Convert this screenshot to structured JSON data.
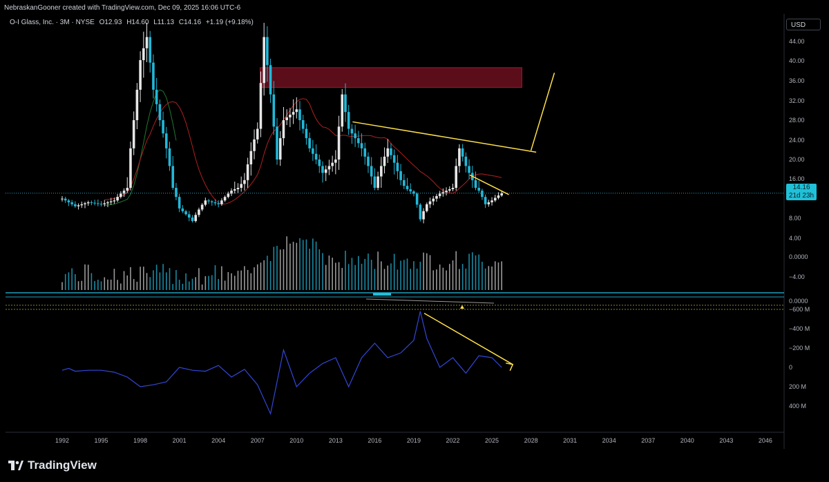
{
  "header": {
    "attribution": "NebraskanGooner created with TradingView.com, Dec 09, 2025 16:06 UTC-6"
  },
  "legend": {
    "symbol": "O-I Glass, Inc. · 3M · NYSE",
    "open_label": "O",
    "open": "12.93",
    "high_label": "H",
    "high": "14.60",
    "low_label": "L",
    "low": "11.13",
    "close_label": "C",
    "close": "14.16",
    "change": "+1.19 (+9.18%)"
  },
  "currency_button": "USD",
  "price_badge": {
    "price": "14.16",
    "countdown": "21d 23h",
    "color": "#20c0d8"
  },
  "branding": {
    "logo_icon": "tradingview-logo-icon",
    "name": "TradingView"
  },
  "colors": {
    "up": "#e6e6e6",
    "down": "#22b8d8",
    "resistance_zone": "#6b0f1e",
    "trendline": "#ffe14a",
    "ma_red": "#b02020",
    "ma_green": "#1f7a2e",
    "indicator_line": "#3347d6",
    "price_dotted": "#2aa9c9"
  },
  "chart_data": [
    {
      "type": "line",
      "title": "O-I Glass, Inc. · 3M · NYSE",
      "x_tick_labels": [
        "1992",
        "1995",
        "1998",
        "2001",
        "2004",
        "2007",
        "2010",
        "2013",
        "2016",
        "2019",
        "2022",
        "2025",
        "2028",
        "2031",
        "2034",
        "2037",
        "2040",
        "2043",
        "2046"
      ],
      "y_tick_labels": [
        "44.00",
        "40.00",
        "36.00",
        "32.00",
        "28.00",
        "24.00",
        "20.00",
        "16.00",
        "8.00",
        "4.00",
        "0.0000",
        "−4.00"
      ],
      "y_scale": "log",
      "ylim": [
        7,
        50
      ],
      "current_price": 14.16,
      "series": [
        {
          "x": [
            1992,
            1993,
            1994,
            1995,
            1996,
            1997,
            1997.5,
            1998,
            1998.5,
            1999,
            2000,
            2001,
            2002,
            2003,
            2004,
            2005,
            2006,
            2007,
            2007.5,
            2008,
            2008.5,
            2009,
            2010,
            2011,
            2012,
            2013,
            2013.5,
            2014,
            2015,
            2016,
            2017,
            2018,
            2019,
            2019.5,
            2020,
            2021,
            2022,
            2022.5,
            2023,
            2024,
            2024.5,
            2025,
            2025.75
          ],
          "values": [
            12.5,
            10.5,
            11.5,
            11,
            12,
            16,
            28,
            40,
            45,
            34,
            22,
            10,
            7.5,
            12,
            11,
            15,
            17,
            26,
            45,
            33,
            20,
            28,
            30,
            22,
            18,
            20,
            33,
            26,
            22,
            16,
            22,
            17,
            14,
            7.8,
            11,
            14,
            16,
            22,
            19,
            15,
            11,
            12,
            14.16
          ]
        }
      ],
      "annotations": [
        {
          "type": "zone",
          "label": "resistance",
          "y_range": [
            34.5,
            38.5
          ],
          "x_range": [
            2007.2,
            2027.3
          ]
        },
        {
          "type": "trendline",
          "points": [
            [
              2014.3,
              27.6
            ],
            [
              2028.4,
              21.3
            ]
          ]
        },
        {
          "type": "trendline",
          "points": [
            [
              2023.3,
              17.7
            ],
            [
              2026.3,
              13.7
            ]
          ]
        },
        {
          "type": "projection",
          "points": [
            [
              2028.0,
              21.6
            ],
            [
              2029.8,
              37.5
            ]
          ]
        }
      ]
    },
    {
      "type": "line",
      "y_tick_labels": [
        "0.0000"
      ]
    },
    {
      "type": "line",
      "y_tick_labels": [
        "400 M",
        "200 M",
        "0",
        "−200 M",
        "−400 M",
        "−600 M"
      ],
      "ylim": [
        -650,
        500
      ],
      "series": [
        {
          "x": [
            1992,
            1992.5,
            1993,
            1994,
            1995,
            1996,
            1997,
            1998,
            1999,
            2000,
            2001,
            2002,
            2003,
            2004,
            2005,
            2006,
            2007,
            2008,
            2008.5,
            2009,
            2010,
            2011,
            2012,
            2013,
            2014,
            2015,
            2016,
            2017,
            2018,
            2019,
            2019.5,
            2020,
            2021,
            2022,
            2023,
            2024,
            2025,
            2025.75
          ],
          "values": [
            30,
            10,
            40,
            30,
            30,
            50,
            100,
            200,
            180,
            150,
            0,
            30,
            40,
            -20,
            100,
            20,
            180,
            480,
            150,
            -180,
            200,
            60,
            -40,
            -100,
            200,
            -100,
            -250,
            -100,
            -150,
            -280,
            -580,
            -300,
            0,
            -100,
            60,
            -120,
            -100,
            0
          ]
        }
      ],
      "annotations": [
        {
          "type": "trendline",
          "points": [
            [
              2019.8,
              -560
            ],
            [
              2026.6,
              -30
            ]
          ]
        }
      ]
    }
  ]
}
